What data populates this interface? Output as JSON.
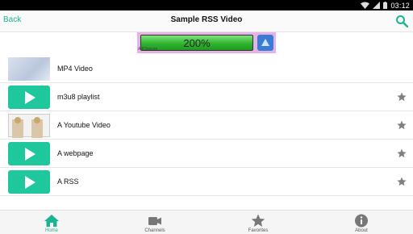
{
  "statusbar": {
    "time": "03:12"
  },
  "appbar": {
    "back_label": "Back",
    "title": "Sample RSS Video"
  },
  "ad": {
    "text": "200%",
    "tag": "AdChoices"
  },
  "items": [
    {
      "label": "MP4 Video",
      "thumbnail": "photo",
      "favorite": false
    },
    {
      "label": "m3u8 playlist",
      "thumbnail": "play-icon",
      "favorite": true
    },
    {
      "label": "A Youtube Video",
      "thumbnail": "photo",
      "favorite": true
    },
    {
      "label": "A webpage",
      "thumbnail": "play-icon",
      "favorite": true
    },
    {
      "label": "A RSS",
      "thumbnail": "play-icon",
      "favorite": true
    }
  ],
  "tabs": [
    {
      "label": "Home",
      "icon": "home-icon",
      "active": true
    },
    {
      "label": "Channels",
      "icon": "video-camera-icon",
      "active": false
    },
    {
      "label": "Favorites",
      "icon": "star-icon",
      "active": false
    },
    {
      "label": "About",
      "icon": "info-icon",
      "active": false
    }
  ],
  "colors": {
    "accent": "#1ab394",
    "play_tile": "#1fc79c",
    "ad_background": "#e6b3e6"
  }
}
